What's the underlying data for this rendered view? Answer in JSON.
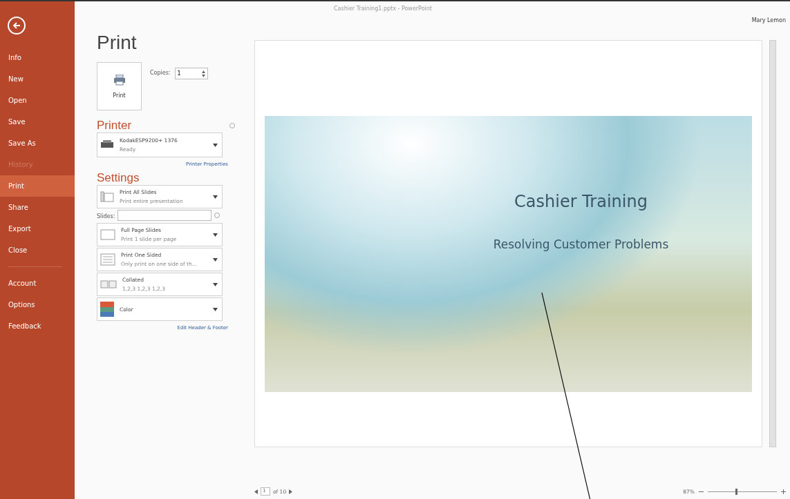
{
  "window": {
    "title": "Cashier Training1.pptx - PowerPoint",
    "user": "Mary Lemon"
  },
  "sidebar": {
    "items": [
      {
        "label": "Info",
        "selected": false,
        "disabled": false
      },
      {
        "label": "New",
        "selected": false,
        "disabled": false
      },
      {
        "label": "Open",
        "selected": false,
        "disabled": false
      },
      {
        "label": "Save",
        "selected": false,
        "disabled": false
      },
      {
        "label": "Save As",
        "selected": false,
        "disabled": false
      },
      {
        "label": "History",
        "selected": false,
        "disabled": true
      },
      {
        "label": "Print",
        "selected": true,
        "disabled": false
      },
      {
        "label": "Share",
        "selected": false,
        "disabled": false
      },
      {
        "label": "Export",
        "selected": false,
        "disabled": false
      },
      {
        "label": "Close",
        "selected": false,
        "disabled": false
      },
      {
        "label": "Account",
        "selected": false,
        "disabled": false,
        "separator_before": true
      },
      {
        "label": "Options",
        "selected": false,
        "disabled": false
      },
      {
        "label": "Feedback",
        "selected": false,
        "disabled": false
      }
    ]
  },
  "print": {
    "heading": "Print",
    "button": "Print",
    "copies_label": "Copies:",
    "copies": "1",
    "printer_heading": "Printer",
    "printer": {
      "name": "KodakESP9200+ 1376",
      "status": "Ready"
    },
    "printer_properties": "Printer Properties",
    "settings_heading": "Settings",
    "slides_label": "Slides:",
    "settings": [
      {
        "kind": "range",
        "title": "Print All Slides",
        "detail": "Print entire presentation"
      },
      {
        "kind": "slides_field"
      },
      {
        "kind": "layout",
        "title": "Full Page Slides",
        "detail": "Print 1 slide per page"
      },
      {
        "kind": "sides",
        "title": "Print One Sided",
        "detail": "Only print on one side of th..."
      },
      {
        "kind": "collate",
        "title": "Collated",
        "detail": "1,2,3   1,2,3   1,2,3"
      },
      {
        "kind": "color",
        "title": "Color"
      }
    ],
    "edit_header_footer": "Edit Header & Footer"
  },
  "preview": {
    "slide_title": "Cashier Training",
    "slide_subtitle": "Resolving Customer Problems",
    "page": "1",
    "page_total": "of 10",
    "zoom": "87%",
    "zoom_slider": {
      "level": 0.4
    }
  }
}
